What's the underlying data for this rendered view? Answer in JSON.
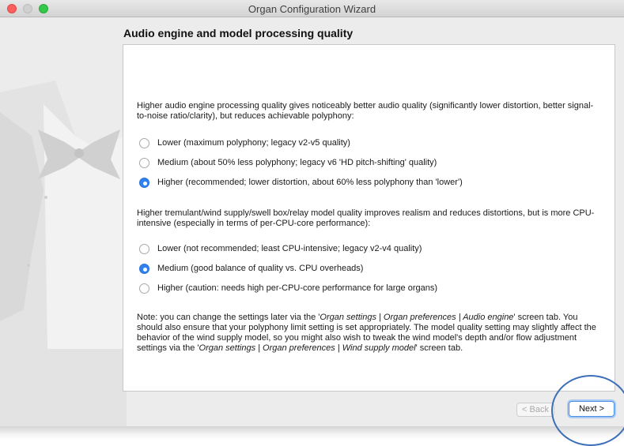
{
  "window": {
    "title": "Organ Configuration Wizard"
  },
  "page": {
    "heading": "Audio engine and model processing quality"
  },
  "audio_engine": {
    "intro": "Higher audio engine processing quality gives noticeably better audio quality (significantly lower distortion, better signal-to-noise ratio/clarity), but reduces achievable polyphony:",
    "options": [
      {
        "label": "Lower (maximum polyphony; legacy v2-v5 quality)",
        "selected": false
      },
      {
        "label": "Medium (about 50% less polyphony; legacy v6 'HD pitch-shifting' quality)",
        "selected": false
      },
      {
        "label": "Higher (recommended; lower distortion, about 60% less polyphony than 'lower')",
        "selected": true
      }
    ]
  },
  "model_quality": {
    "intro": "Higher tremulant/wind supply/swell box/relay model quality improves realism and reduces distortions, but is more CPU-intensive (especially in terms of per-CPU-core performance):",
    "options": [
      {
        "label": "Lower (not recommended; least CPU-intensive; legacy v2-v4 quality)",
        "selected": false
      },
      {
        "label": "Medium (good balance of quality vs. CPU overheads)",
        "selected": true
      },
      {
        "label": "Higher (caution: needs high per-CPU-core performance for large organs)",
        "selected": false
      }
    ]
  },
  "note": {
    "part1": "Note: you can change the settings later via the '",
    "link1": "Organ settings | Organ preferences | Audio engine",
    "part2": "' screen tab. You should also ensure that your polyphony limit setting is set appropriately. The model quality setting may slightly affect the behavior of the wind supply model, so you might also wish to tweak the wind model's depth and/or flow adjustment settings via the '",
    "link2": "Organ settings | Organ preferences | Wind supply model",
    "part3": "' screen tab."
  },
  "buttons": {
    "back": "< Back",
    "next": "Next >"
  },
  "colors": {
    "accent": "#2f80f0",
    "annotation_ring": "#3d6fb8"
  },
  "icons": {
    "watermark": "tuxedo-watermark-icon"
  }
}
